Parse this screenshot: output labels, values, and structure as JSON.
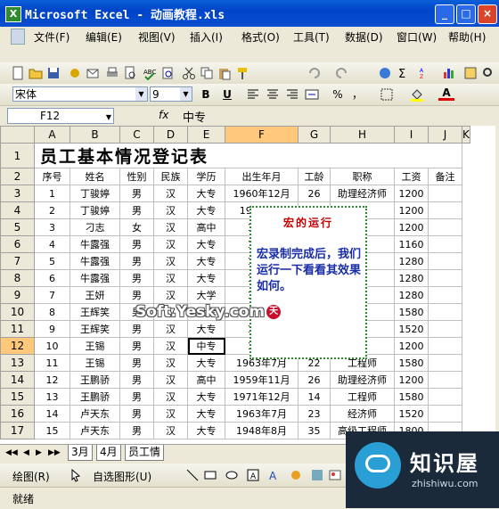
{
  "window": {
    "title": "Microsoft Excel - 动画教程.xls",
    "min": "_",
    "max": "□",
    "close": "×",
    "app_icon": "X"
  },
  "menu": [
    "文件(F)",
    "编辑(E)",
    "视图(V)",
    "插入(I)",
    "格式(O)",
    "工具(T)",
    "数据(D)",
    "窗口(W)",
    "帮助(H)"
  ],
  "format_toolbar": {
    "font": "宋体",
    "size": "9",
    "bold": "B",
    "underline": "U",
    "percent": "%",
    "comma": "，",
    "fill_label": "A"
  },
  "formula_bar": {
    "cell_ref": "F12",
    "fx": "fx",
    "value": "中专"
  },
  "columns": [
    "A",
    "B",
    "C",
    "D",
    "E",
    "F",
    "G",
    "H",
    "I",
    "J",
    "K"
  ],
  "selected_column": "F",
  "selected_row": "12",
  "sheet_title": "员工基本情况登记表",
  "headers": [
    "序号",
    "姓名",
    "性别",
    "民族",
    "学历",
    "出生年月",
    "工龄",
    "职称",
    "工资",
    "备注"
  ],
  "rows": [
    [
      "1",
      "丁骏婷",
      "男",
      "汉",
      "大专",
      "1960年12月",
      "26",
      "助理经济师",
      "1200",
      ""
    ],
    [
      "2",
      "丁骏婷",
      "男",
      "汉",
      "大专",
      "1959年...",
      "",
      "师",
      "1200",
      ""
    ],
    [
      "3",
      "刁志",
      "女",
      "汉",
      "高中",
      "196...",
      "",
      "师",
      "1200",
      ""
    ],
    [
      "4",
      "牛露强",
      "男",
      "汉",
      "大专",
      "196...",
      "",
      "师",
      "1160",
      ""
    ],
    [
      "5",
      "牛露强",
      "男",
      "汉",
      "大专",
      "194...",
      "",
      "师",
      "1280",
      ""
    ],
    [
      "6",
      "牛露强",
      "男",
      "汉",
      "大专",
      "196...",
      "",
      "师",
      "1280",
      ""
    ],
    [
      "7",
      "王妍",
      "男",
      "汉",
      "大学",
      "197...",
      "",
      "师",
      "1280",
      ""
    ],
    [
      "8",
      "王辉笑",
      "男",
      "汉",
      "大专",
      "19...",
      "",
      "师",
      "1580",
      ""
    ],
    [
      "9",
      "王辉笑",
      "男",
      "汉",
      "大专",
      "194...",
      "",
      "师",
      "1520",
      ""
    ],
    [
      "10",
      "王锡",
      "男",
      "汉",
      "中专",
      "195...",
      "",
      "",
      "1200",
      ""
    ],
    [
      "11",
      "王锡",
      "男",
      "汉",
      "大专",
      "1963年7月",
      "22",
      "工程师",
      "1580",
      ""
    ],
    [
      "12",
      "王鹏骄",
      "男",
      "汉",
      "高中",
      "1959年11月",
      "26",
      "助理经济师",
      "1200",
      ""
    ],
    [
      "13",
      "王鹏骄",
      "男",
      "汉",
      "大专",
      "1971年12月",
      "14",
      "工程师",
      "1580",
      ""
    ],
    [
      "14",
      "卢天东",
      "男",
      "汉",
      "大专",
      "1963年7月",
      "23",
      "经济师",
      "1520",
      ""
    ],
    [
      "15",
      "卢天东",
      "男",
      "汉",
      "大专",
      "1948年8月",
      "35",
      "高级工程师",
      "1800",
      ""
    ]
  ],
  "macro_note": {
    "title": "宏的运行",
    "body": "宏录制完成后，我们运行一下看看其效果如何。"
  },
  "watermark": "Soft.Yesky.com",
  "watermark_logo": "天",
  "sheet_tabs": [
    "3月",
    "4月",
    "员工情"
  ],
  "tab_nav": [
    "◀◀",
    "◀",
    "▶",
    "▶▶"
  ],
  "draw_toolbar": {
    "draw": "绘图(R)",
    "autoshapes": "自选图形(U)"
  },
  "status": "就绪",
  "logo": {
    "name": "知识屋",
    "url": "zhishiwu.com"
  }
}
